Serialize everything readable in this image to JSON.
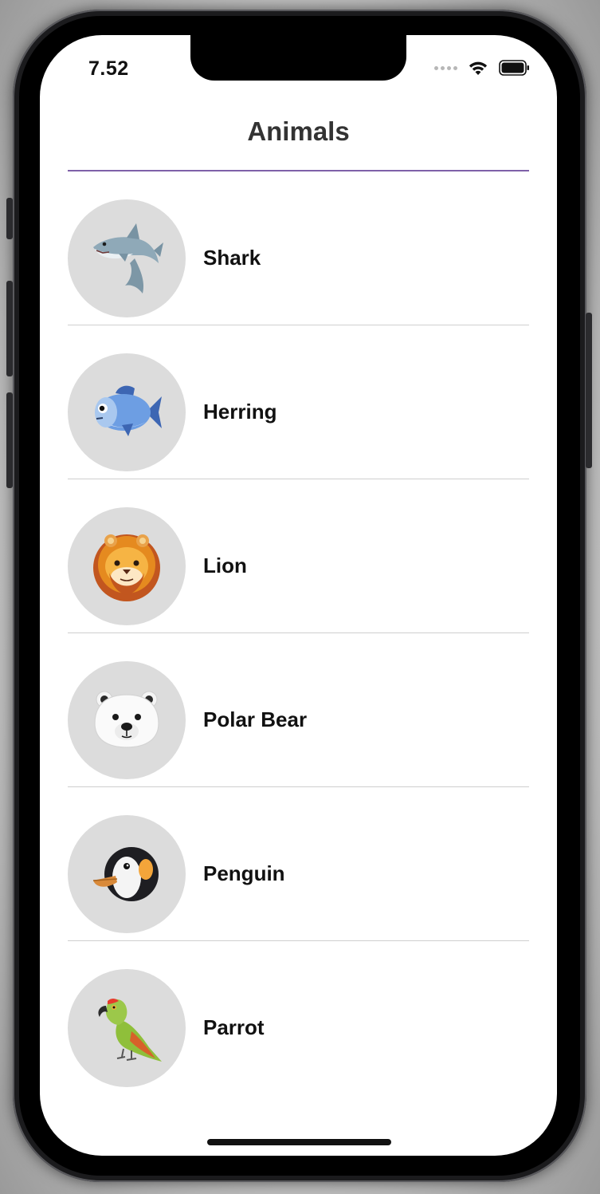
{
  "status_bar": {
    "time": "7.52",
    "wifi_icon": "wifi-icon",
    "battery_icon": "battery-icon",
    "signal_icon": "cellular-signal-icon"
  },
  "nav": {
    "title": "Animals",
    "divider_color": "#7f61a8"
  },
  "animals": [
    {
      "name": "Shark",
      "icon": "shark-icon"
    },
    {
      "name": "Herring",
      "icon": "fish-icon"
    },
    {
      "name": "Lion",
      "icon": "lion-icon"
    },
    {
      "name": "Polar Bear",
      "icon": "polar-bear-icon"
    },
    {
      "name": "Penguin",
      "icon": "penguin-icon"
    },
    {
      "name": "Parrot",
      "icon": "parrot-icon"
    }
  ],
  "colors": {
    "avatar_background": "#dcdcdc",
    "row_divider": "#cfcfcf",
    "screen_background": "#ffffff"
  }
}
